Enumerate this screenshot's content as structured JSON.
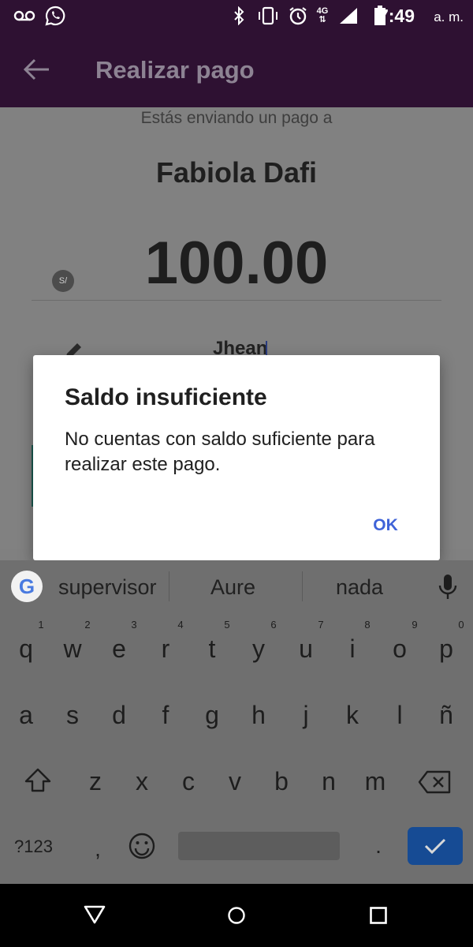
{
  "status_bar": {
    "time": "7:49",
    "ampm": "a. m.",
    "network": "4G",
    "icons": [
      "voicemail-icon",
      "whatsapp-icon",
      "bluetooth-icon",
      "vibrate-icon",
      "alarm-icon",
      "network-4g-icon",
      "signal-icon",
      "battery-icon"
    ]
  },
  "app_bar": {
    "title": "Realizar pago",
    "back_icon": "arrow-left-icon"
  },
  "payment": {
    "subtitle": "Estás enviando un pago a",
    "payee": "Fabiola Dafi",
    "currency": "S/",
    "amount": "100.00",
    "note_value": "Jhean",
    "note_icon": "pencil-icon"
  },
  "dialog": {
    "title": "Saldo insuficiente",
    "message": "No cuentas con saldo suficiente para realizar este pago.",
    "ok_label": "OK"
  },
  "keyboard": {
    "suggestions": [
      "supervisor",
      "Aure",
      "nada"
    ],
    "row1": [
      "q",
      "w",
      "e",
      "r",
      "t",
      "y",
      "u",
      "i",
      "o",
      "p"
    ],
    "row1_numbers": [
      "1",
      "2",
      "3",
      "4",
      "5",
      "6",
      "7",
      "8",
      "9",
      "0"
    ],
    "row2": [
      "a",
      "s",
      "d",
      "f",
      "g",
      "h",
      "j",
      "k",
      "l",
      "ñ"
    ],
    "row3": [
      "z",
      "x",
      "c",
      "v",
      "b",
      "n",
      "m"
    ],
    "symbols_label": "?123",
    "comma": ",",
    "period": ".",
    "google_logo": "G",
    "colors": {
      "enter": "#164b94",
      "background": "#6f6f6f"
    }
  },
  "colors": {
    "app_bar": "#2e1132",
    "dialog_button": "#3f63d8",
    "accent_teal": "#1b5a4f"
  }
}
